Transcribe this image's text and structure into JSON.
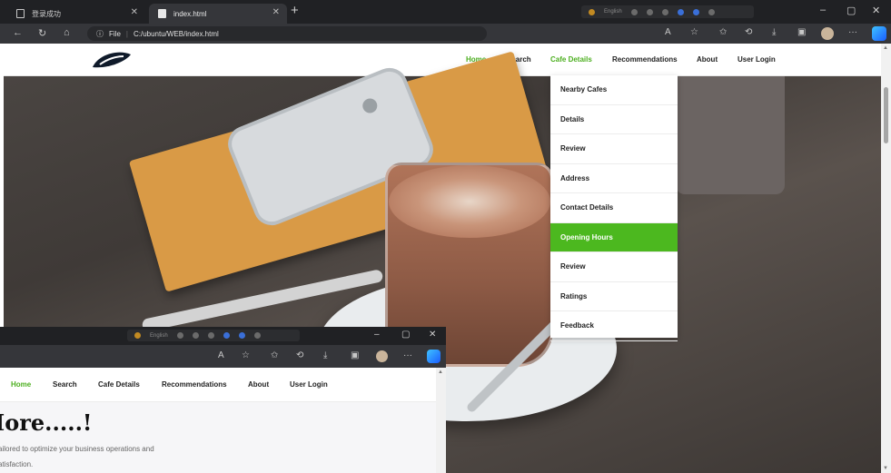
{
  "browser": {
    "tabs": [
      {
        "title": "登录成功",
        "active": false
      },
      {
        "title": "index.html",
        "active": true
      }
    ],
    "new_tab": "+",
    "tray_text": "English",
    "file_label": "File",
    "url": "C:/ubuntu/WEB/index.html",
    "controls": {
      "minimize": "–",
      "maximize": "▢",
      "close": "✕"
    }
  },
  "site": {
    "nav": [
      {
        "label": "Home",
        "active": true
      },
      {
        "label": "Search",
        "active": false
      },
      {
        "label": "Cafe Details",
        "active": true
      },
      {
        "label": "Recommendations",
        "active": false
      },
      {
        "label": "About",
        "active": false
      },
      {
        "label": "User Login",
        "active": false
      }
    ],
    "dropdown": [
      {
        "label": "Nearby Cafes",
        "active": false
      },
      {
        "label": "Details",
        "active": false
      },
      {
        "label": "Review",
        "active": false
      },
      {
        "label": "Address",
        "active": false
      },
      {
        "label": "Contact Details",
        "active": false
      },
      {
        "label": "Opening Hours",
        "active": true
      },
      {
        "label": "Review",
        "active": false
      },
      {
        "label": "Ratings",
        "active": false
      },
      {
        "label": "Feedback",
        "active": false
      }
    ]
  },
  "window2": {
    "tray_text": "English",
    "nav": [
      {
        "label": "Home",
        "active": true
      },
      {
        "label": "Search",
        "active": false
      },
      {
        "label": "Cafe Details",
        "active": false
      },
      {
        "label": "Recommendations",
        "active": false
      },
      {
        "label": "About",
        "active": false
      },
      {
        "label": "User Login",
        "active": false
      }
    ],
    "heading": "Iore.....!",
    "text_line1": "ailored to optimize your business operations and",
    "text_line2": "atisfaction."
  },
  "colors": {
    "accent": "#4caf1f",
    "dropdown_active": "#4cb81f",
    "chrome_dark": "#202124",
    "chrome_mid": "#35363a"
  }
}
